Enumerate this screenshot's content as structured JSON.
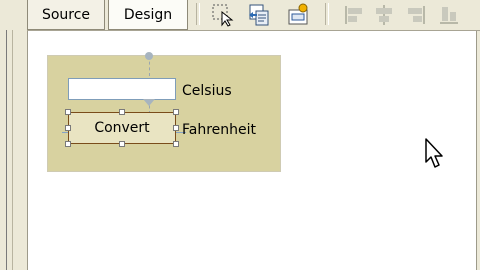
{
  "tabs": [
    {
      "label": "Source",
      "active": false
    },
    {
      "label": "Design",
      "active": true
    }
  ],
  "toolbar": {
    "icons": [
      "select-pointer-icon",
      "copy-format-icon",
      "open-icon",
      "align-left-icon",
      "align-center-icon",
      "align-right-icon",
      "align-bottom-icon"
    ]
  },
  "form": {
    "textbox_value": "",
    "label_celsius": "Celsius",
    "button_label": "Convert",
    "label_fahrenheit": "Fahrenheit"
  },
  "colors": {
    "form_background": "#d8d2a0",
    "toolbar_background": "#ece9d8",
    "button_border": "#7a4c1a"
  }
}
